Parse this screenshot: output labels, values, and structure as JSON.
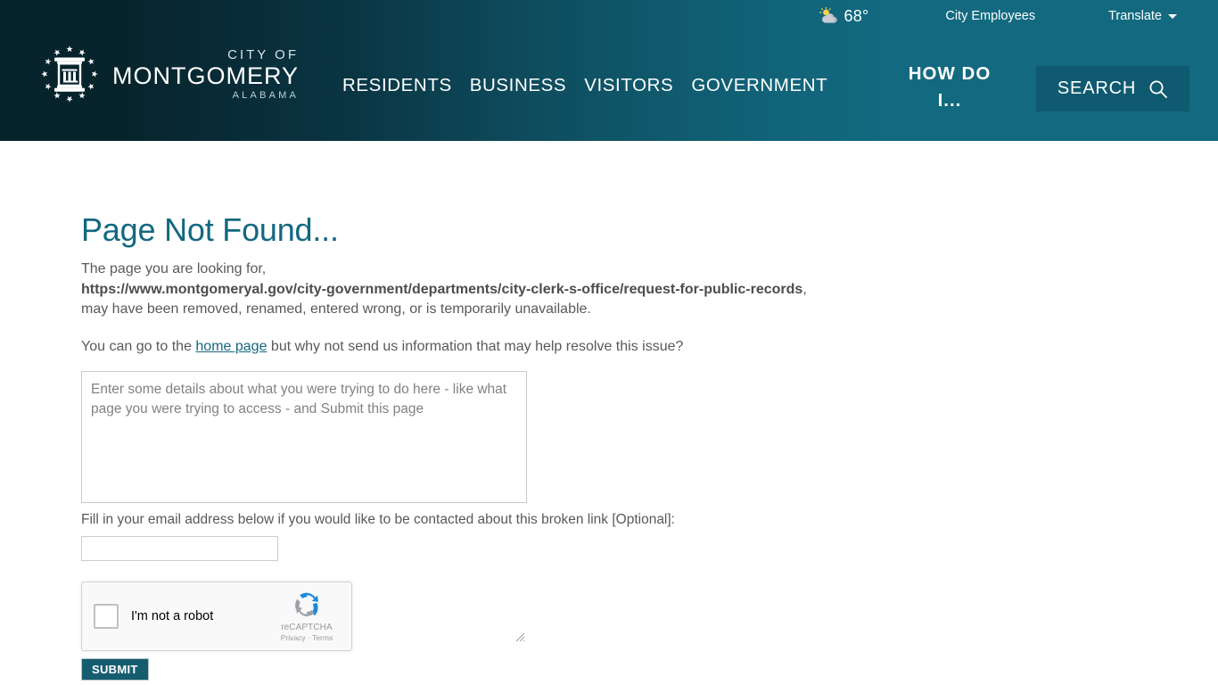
{
  "header": {
    "utility": {
      "weather_icon": "sun-behind-cloud-icon",
      "temperature": "68°",
      "city_employees_label": "City Employees",
      "translate_label": "Translate",
      "translate_caret": "chevron-down-icon"
    },
    "logo": {
      "mark": "montgomery-column-stars-icon",
      "line1": "CITY OF",
      "line2": "MONTGOMERY",
      "line3": "ALABAMA"
    },
    "nav_items": [
      {
        "label": "RESIDENTS"
      },
      {
        "label": "BUSINESS"
      },
      {
        "label": "VISITORS"
      },
      {
        "label": "GOVERNMENT"
      }
    ],
    "how_do_i_label": "HOW DO I...",
    "search": {
      "label": "SEARCH",
      "icon": "search-icon"
    },
    "colors": {
      "gradient_left": "#07242c",
      "gradient_right": "#136a80",
      "search_box": "#0f5a70"
    }
  },
  "main": {
    "title": "Page Not Found...",
    "paragraph1_before": "The page you are looking for,",
    "broken_url": "https://www.montgomeryal.gov/city-government/departments/city-clerk-s-office/request-for-public-records",
    "paragraph1_after": "may have been removed, renamed, entered wrong, or is temporarily unavailable.",
    "paragraph2_before": "You can go to the ",
    "home_link_label": "home page",
    "paragraph2_after": " but why not send us information that may help resolve this issue?",
    "details_placeholder": "Enter some details about what you were trying to do here - like what page you were trying to access - and Submit this page",
    "details_value": "",
    "email_label": "Fill in your email address below if you would like to be contacted about this broken link [Optional]:",
    "email_value": "",
    "email_placeholder": "",
    "recaptcha": {
      "checkbox_icon": "empty-checkbox-icon",
      "label": "I'm not a robot",
      "logo_icon": "recaptcha-logo-icon",
      "brand": "reCAPTCHA",
      "privacy_label": "Privacy",
      "separator": " · ",
      "terms_label": "Terms"
    },
    "submit_label": "SUBMIT",
    "colors": {
      "title": "#136880",
      "link": "#136880",
      "body_text": "#58595b",
      "submit_bg": "#165c6f"
    }
  }
}
